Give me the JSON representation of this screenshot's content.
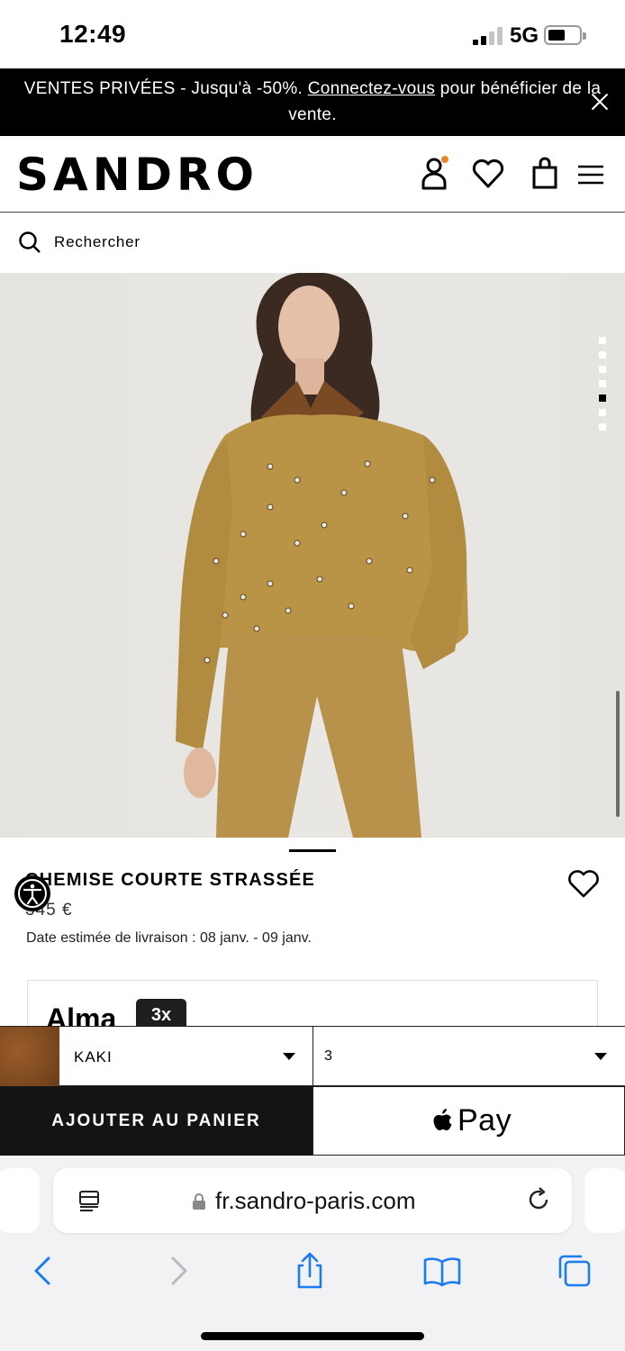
{
  "status_bar": {
    "time": "12:49",
    "network": "5G"
  },
  "promo": {
    "text_before": "VENTES PRIVÉES - Jusqu'à -50%. ",
    "link": "Connectez-vous",
    "text_after": " pour bénéficier de la vente."
  },
  "header": {
    "logo": "SANDRO"
  },
  "search": {
    "label": "Rechercher"
  },
  "gallery": {
    "total_images": 7,
    "active_index": 5
  },
  "product": {
    "title": "CHEMISE COURTE STRASSÉE",
    "price": "345 €",
    "delivery": "Date estimée de livraison : 08 janv. - 09 janv."
  },
  "alma": {
    "logo": "Alma",
    "badge": "3x"
  },
  "selectors": {
    "color": "KAKI",
    "size": "3"
  },
  "actions": {
    "add_to_cart": "AJOUTER AU PANIER",
    "apple_pay": "Pay"
  },
  "safari": {
    "url": "fr.sandro-paris.com"
  },
  "colors": {
    "promo_bg": "#000000",
    "accent_dot": "#e6882b",
    "link_blue": "#1a7cf0"
  }
}
